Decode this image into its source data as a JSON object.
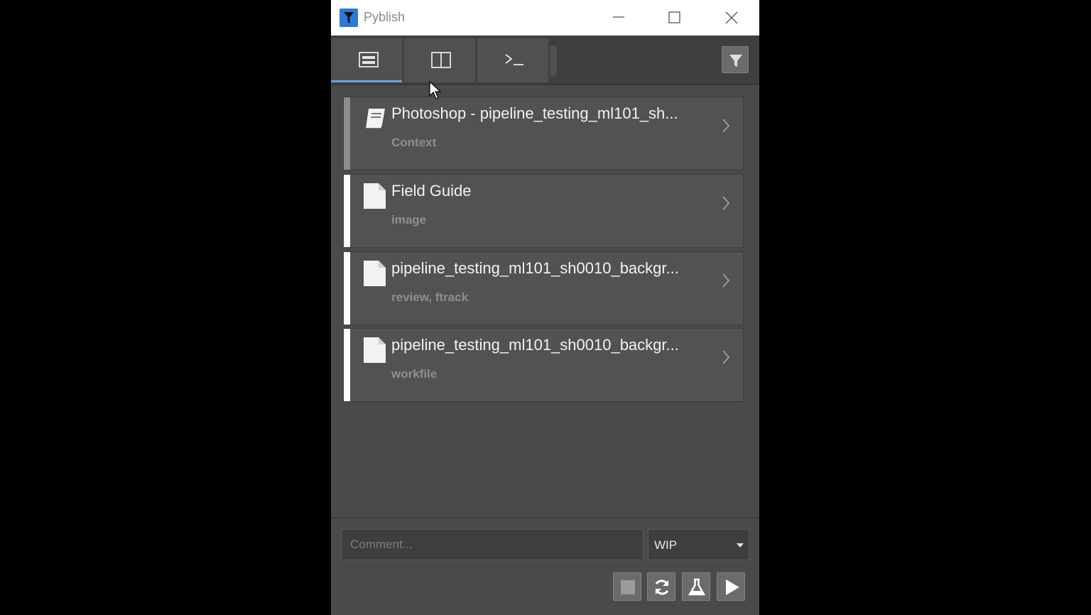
{
  "window": {
    "title": "Pyblish"
  },
  "tabs": [
    {
      "icon": "overview-icon",
      "active": true
    },
    {
      "icon": "split-view-icon",
      "active": false
    },
    {
      "icon": "terminal-icon",
      "active": false
    }
  ],
  "list": {
    "items": [
      {
        "title": "Photoshop - pipeline_testing_ml101_sh...",
        "subtitle": "Context",
        "icon": "book-icon"
      },
      {
        "title": "Field Guide",
        "subtitle": "image",
        "icon": "file-icon"
      },
      {
        "title": "pipeline_testing_ml101_sh0010_backgr...",
        "subtitle": "review, ftrack",
        "icon": "file-icon"
      },
      {
        "title": "pipeline_testing_ml101_sh0010_backgr...",
        "subtitle": "workfile",
        "icon": "file-icon"
      }
    ]
  },
  "footer": {
    "comment_placeholder": "Comment...",
    "comment_value": "",
    "variant_selected": "WIP"
  },
  "colors": {
    "accent": "#6aa3d6",
    "app_icon": "#2b7ad8",
    "background": "#4a4a4a"
  }
}
